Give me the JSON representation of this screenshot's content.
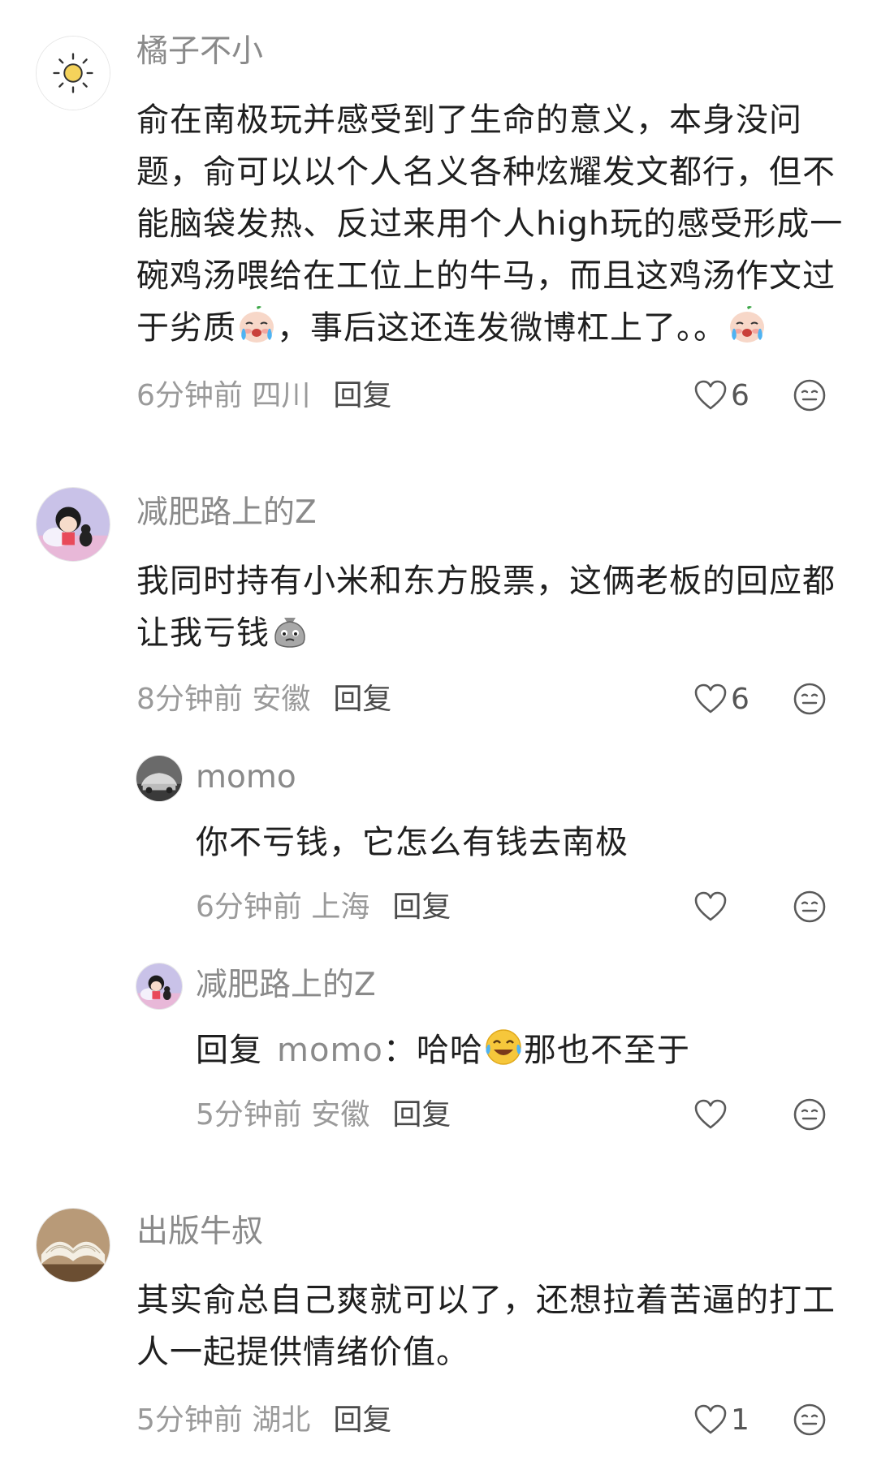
{
  "comments": [
    {
      "username": "橘子不小",
      "avatar": "sun-icon",
      "text_part1": "俞在南极玩并感受到了生命的意义，本身没问题，俞可以以个人名义各种炫耀发文都行，但不能脑袋发热、反过来用个人high玩的感受形成一碗鸡汤喂给在工位上的牛马，而且这鸡汤作文过于劣质",
      "emoji1": "crying-face-emoji",
      "text_part2": "，事后这还连发微博杠上了。。",
      "emoji2": "crying-face-emoji",
      "time": "6分钟前 四川",
      "reply": "回复",
      "likes": "6"
    },
    {
      "username": "减肥路上的Z",
      "avatar": "cartoon-girl-avatar",
      "text_part1": "我同时持有小米和东方股票，这俩老板的回应都让我亏钱",
      "emoji1": "sad-moneybag-emoji",
      "time": "8分钟前 安徽",
      "reply": "回复",
      "likes": "6",
      "replies": [
        {
          "username": "momo",
          "avatar": "car-avatar",
          "text": "你不亏钱，它怎么有钱去南极",
          "time": "6分钟前 上海",
          "reply": "回复"
        },
        {
          "username": "减肥路上的Z",
          "avatar": "cartoon-girl-avatar",
          "prefix": "回复",
          "mention": "momo",
          "colon": "：",
          "text_before": "哈哈",
          "emoji": "laughing-tears-emoji",
          "text_after": "那也不至于",
          "time": "5分钟前 安徽",
          "reply": "回复"
        }
      ]
    },
    {
      "username": "出版牛叔",
      "avatar": "open-book-avatar",
      "text": "其实俞总自己爽就可以了，还想拉着苦逼的打工人一起提供情绪价值。",
      "time": "5分钟前 湖北",
      "reply": "回复",
      "likes": "1"
    }
  ]
}
